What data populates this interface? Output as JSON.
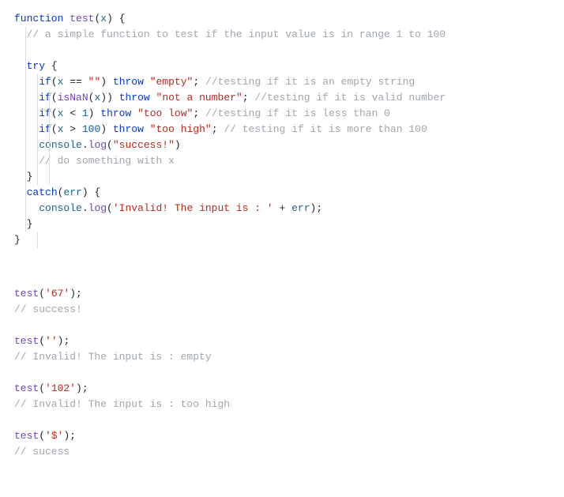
{
  "code": {
    "l1": {
      "kw1": "function",
      "fn": "test",
      "p1": "(",
      "arg": "x",
      "p2": ")",
      "p3": " {"
    },
    "l2": {
      "com": "// a simple function to test if the input value is in range 1 to 100"
    },
    "l3": {
      "kw": "try",
      "p": " {"
    },
    "l4": {
      "kw1": "if",
      "p1": "(",
      "v": "x",
      "op": " == ",
      "s": "\"\"",
      "p2": ") ",
      "kw2": "throw",
      "sp": " ",
      "s2": "\"empty\"",
      "p3": ";",
      "com": " //testing if it is an empty string"
    },
    "l5": {
      "kw1": "if",
      "p1": "(",
      "fn": "isNaN",
      "p2": "(",
      "v": "x",
      "p3": ")) ",
      "kw2": "throw",
      "sp": " ",
      "s": "\"not a number\"",
      "p4": ";",
      "com": " //testing if it is valid number"
    },
    "l6": {
      "kw1": "if",
      "p1": "(",
      "v": "x",
      "op": " < ",
      "n": "1",
      "p2": ") ",
      "kw2": "throw",
      "sp": " ",
      "s": "\"too low\"",
      "p3": ";",
      "com": " //testing if it is less than 0"
    },
    "l7": {
      "kw1": "if",
      "p1": "(",
      "v": "x",
      "op": " > ",
      "n": "100",
      "p2": ") ",
      "kw2": "throw",
      "sp": " ",
      "s": "\"too high\"",
      "p3": ";",
      "com": " // testing if it is more than 100"
    },
    "l8": {
      "obj": "console",
      "dot": ".",
      "m": "log",
      "p1": "(",
      "s": "\"success!\"",
      "p2": ")"
    },
    "l9": {
      "com": "// do something with x"
    },
    "l10": {
      "p": "}"
    },
    "l11": {
      "kw": "catch",
      "p1": "(",
      "v": "err",
      "p2": ") {"
    },
    "l12": {
      "obj": "console",
      "dot": ".",
      "m": "log",
      "p1": "(",
      "s": "'Invalid! The input is : '",
      "op": " + ",
      "v": "err",
      "p2": ");"
    },
    "l13": {
      "p": "}"
    },
    "l14": {
      "p": "}"
    }
  },
  "calls": [
    {
      "fn": "test",
      "arg": "'67'",
      "out": "// success!"
    },
    {
      "fn": "test",
      "arg": "''",
      "out": "// Invalid! The input is : empty"
    },
    {
      "fn": "test",
      "arg": "'102'",
      "out": "// Invalid! The input is : too high"
    },
    {
      "fn": "test",
      "arg": "'$'",
      "out": "// sucess"
    }
  ],
  "punct": {
    "open": "(",
    "close": ");"
  }
}
